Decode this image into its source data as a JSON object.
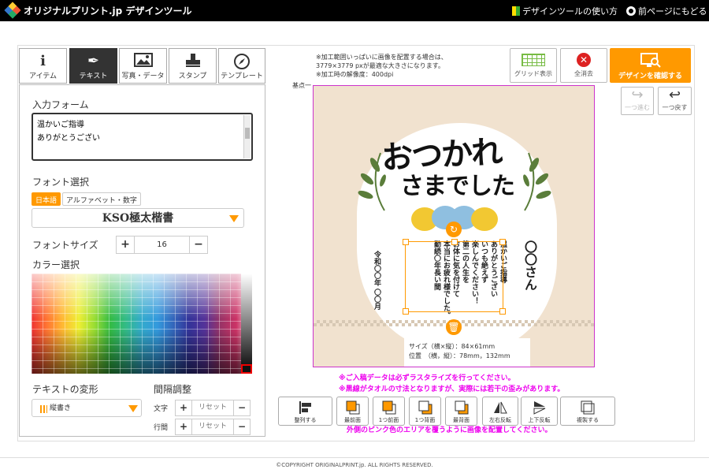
{
  "header": {
    "logo_text": "オリジナルプリント.jp デザインツール",
    "howto": "デザインツールの使い方",
    "back": "前ページにもどる"
  },
  "tabs": [
    {
      "label": "アイテム",
      "icon": "info-icon"
    },
    {
      "label": "テキスト",
      "icon": "pen-icon",
      "active": true
    },
    {
      "label": "写真・データ",
      "icon": "image-icon"
    },
    {
      "label": "スタンプ",
      "icon": "stamp-icon"
    },
    {
      "label": "テンプレート",
      "icon": "compass-icon"
    }
  ],
  "text_panel": {
    "input_label": "入力フォーム",
    "input_value": "温かいご指導\nありがとうござい",
    "font_label": "フォント選択",
    "font_tab_ja": "日本語",
    "font_tab_alpha": "アルファベット・数字",
    "font_selected": "KSO極太楷書",
    "font_size_label": "フォントサイズ",
    "font_size_value": "16",
    "color_label": "カラー選択",
    "transform_label": "テキストの変形",
    "transform_value": "縦書き",
    "spacing_label": "間隔調整",
    "char_label": "文字",
    "line_label": "行間",
    "reset": "リセット"
  },
  "toolbar": {
    "note": [
      "※加工範囲いっぱいに画像を配置する場合は、",
      "3779×3779 pxが最適な大きさになります。",
      "※加工時の解像度：400dpi"
    ],
    "grid": "グリッド表示",
    "clear": "全消去",
    "confirm": "デザインを確認する",
    "redo": "一つ進む",
    "undo": "一つ戻す",
    "guide": "基点一"
  },
  "design": {
    "title_line1": "おつかれ",
    "title_line2": "さまでした",
    "message": "温かいご指導\nありがとうござい\nいつも絶えず\n楽しんでください！\n第二の人生を\nお体に気を付けて\n本当にお疲れ様でした。\n勤続〇年長い間",
    "name": "〇〇さん",
    "date": "令和〇〇年 〇〇月",
    "colors": {
      "bg": "#f1e2cf",
      "accent": "#ff9900",
      "flower_yellow": "#f2c832",
      "flower_blue": "#8fbfe0",
      "leaf": "#5a7d3a"
    }
  },
  "info": {
    "size": "サイズ（横×縦）：84×61mm",
    "pos": "位置　（横，縦）：78mm，132mm"
  },
  "warnings": [
    "※ご入稿データは必ずラスタライズを行ってください。",
    "※黒線がタオルの寸法となりますが、実際には若干の歪みがあります。",
    "外側のピンク色のエリアを覆うように画像を配置してください。"
  ],
  "bottom_buttons": [
    {
      "label": "整列する",
      "icon": "align-icon"
    },
    {
      "label": "最前面",
      "icon": "front-icon"
    },
    {
      "label": "1つ前面",
      "icon": "forward-icon"
    },
    {
      "label": "1つ背面",
      "icon": "backward-icon"
    },
    {
      "label": "最背面",
      "icon": "back-icon"
    },
    {
      "label": "左右反転",
      "icon": "flip-h-icon"
    },
    {
      "label": "上下反転",
      "icon": "flip-v-icon"
    },
    {
      "label": "複製する",
      "icon": "duplicate-icon"
    }
  ],
  "footer": "©COPYRIGHT ORIGINALPRINT.jp. ALL RIGHTS RESERVED."
}
